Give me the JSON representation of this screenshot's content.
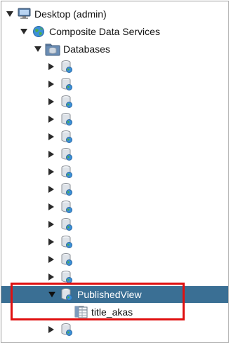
{
  "tree": {
    "root": {
      "label": "Desktop (admin)",
      "icon": "computer-icon"
    },
    "composite": {
      "label": "Composite Data Services",
      "icon": "globe-icon"
    },
    "databases": {
      "label": "Databases",
      "icon": "database-folder-icon"
    },
    "database_items_count": 13,
    "published": {
      "label": "PublishedView",
      "icon": "database-icon",
      "selected": true
    },
    "table": {
      "label": "title_akas",
      "icon": "table-icon"
    },
    "after_items_count": 1
  },
  "colors": {
    "selection": "#3a6f94",
    "highlight": "#e01010"
  }
}
